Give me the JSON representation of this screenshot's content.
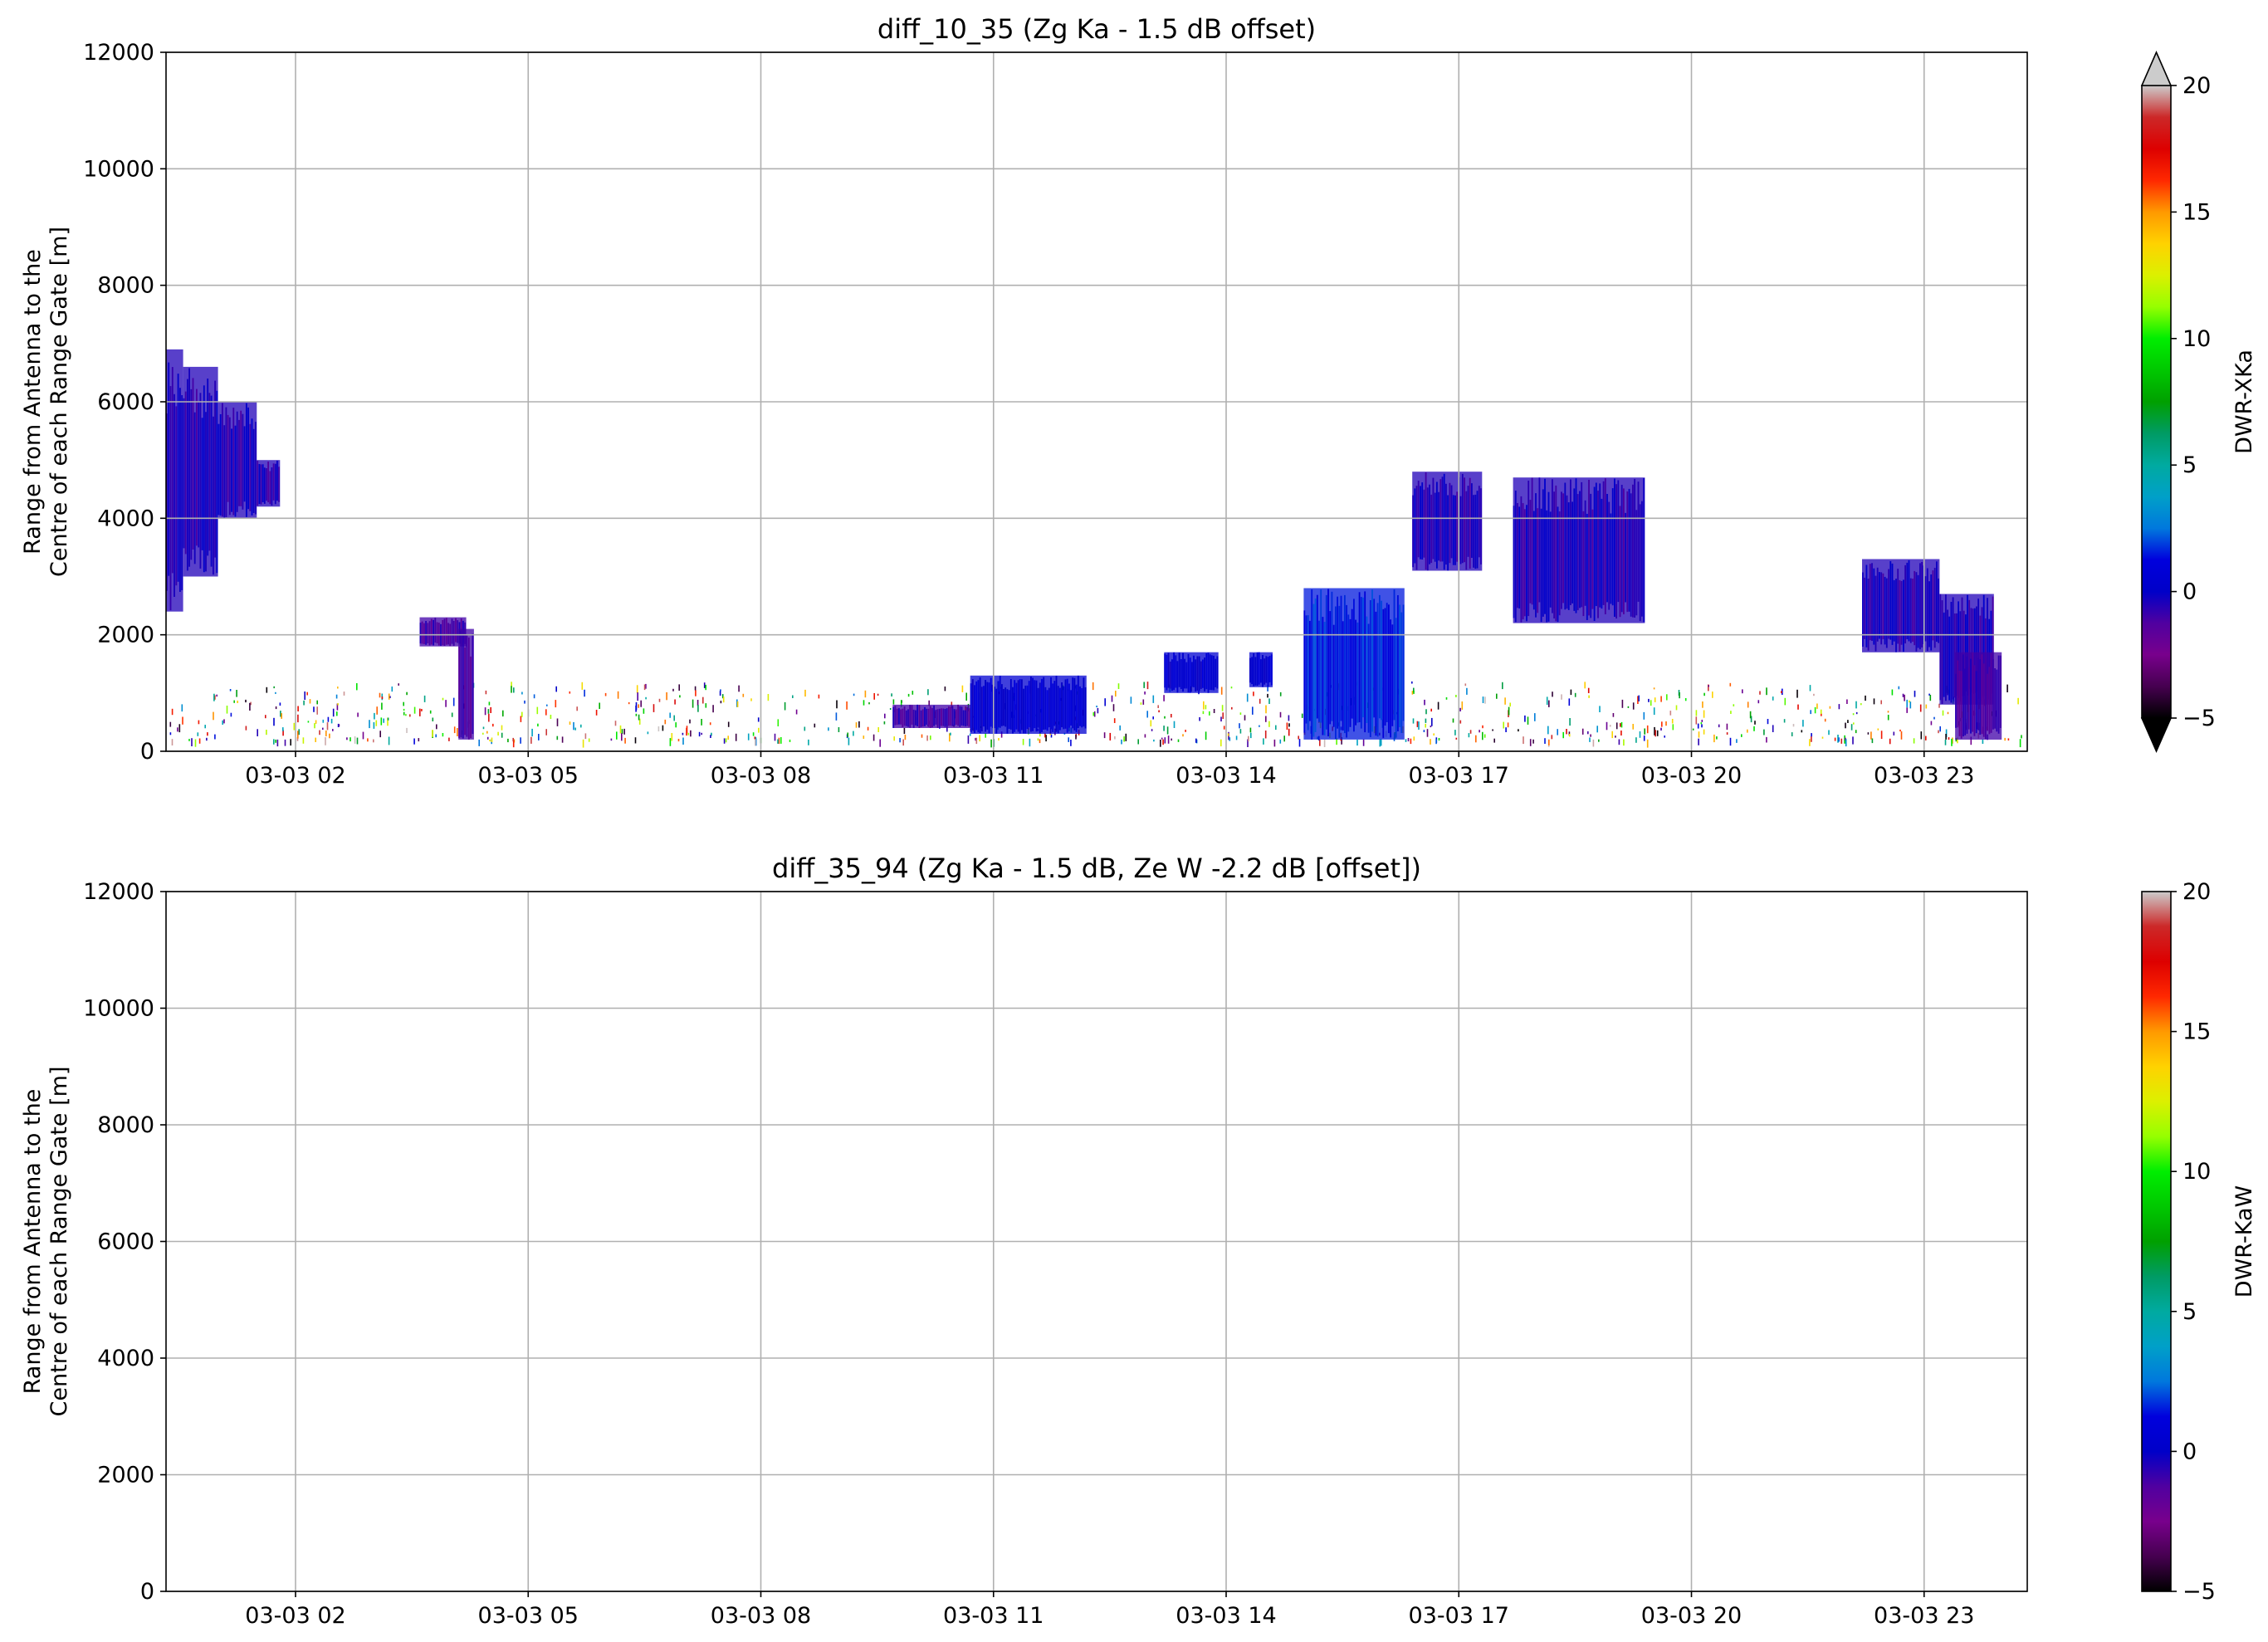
{
  "chart_data": [
    {
      "type": "heatmap",
      "title": "diff_10_35 (Zg Ka - 1.5 dB offset)",
      "xlabel": "",
      "ylabel_lines": [
        "Range from Antenna to the",
        "Centre of each Range Gate [m]"
      ],
      "x_unit": "hours since 03-03 00:00",
      "xlim": [
        0.33,
        24.33
      ],
      "x_tick_values": [
        2,
        5,
        8,
        11,
        14,
        17,
        20,
        23
      ],
      "x_tick_labels": [
        "03-03 02",
        "03-03 05",
        "03-03 08",
        "03-03 11",
        "03-03 14",
        "03-03 17",
        "03-03 20",
        "03-03 23"
      ],
      "ylim": [
        0,
        12000
      ],
      "y_tick_values": [
        0,
        2000,
        4000,
        6000,
        8000,
        10000,
        12000
      ],
      "y_tick_labels": [
        "0",
        "2000",
        "4000",
        "6000",
        "8000",
        "10000",
        "12000"
      ],
      "grid": true,
      "colorbar": {
        "label": "DWR-XKa",
        "range": [
          -5,
          20
        ],
        "tick_values": [
          -5,
          0,
          5,
          10,
          15,
          20
        ],
        "tick_labels": [
          "−5",
          "0",
          "5",
          "10",
          "15",
          "20"
        ],
        "extend": "both",
        "colormap": "nipy_spectral"
      },
      "echo_regions": [
        {
          "x0": 0.33,
          "x1": 0.55,
          "y_bottom": 2400,
          "y_top": 6900,
          "value": -0.5
        },
        {
          "x0": 0.55,
          "x1": 1.0,
          "y_bottom": 3000,
          "y_top": 6600,
          "value": -0.5
        },
        {
          "x0": 1.0,
          "x1": 1.5,
          "y_bottom": 4000,
          "y_top": 6000,
          "value": -0.5
        },
        {
          "x0": 1.5,
          "x1": 1.8,
          "y_bottom": 4200,
          "y_top": 5000,
          "value": -0.5
        },
        {
          "x0": 3.6,
          "x1": 4.2,
          "y_bottom": 1800,
          "y_top": 2300,
          "value": -1.0
        },
        {
          "x0": 4.1,
          "x1": 4.3,
          "y_bottom": 200,
          "y_top": 2100,
          "value": -1.0
        },
        {
          "x0": 9.7,
          "x1": 10.7,
          "y_bottom": 400,
          "y_top": 800,
          "value": -1.0
        },
        {
          "x0": 10.7,
          "x1": 12.2,
          "y_bottom": 300,
          "y_top": 1300,
          "value": 0.5
        },
        {
          "x0": 13.2,
          "x1": 13.9,
          "y_bottom": 1000,
          "y_top": 1700,
          "value": 0.5
        },
        {
          "x0": 14.3,
          "x1": 14.6,
          "y_bottom": 1100,
          "y_top": 1700,
          "value": 0.5
        },
        {
          "x0": 15.0,
          "x1": 16.3,
          "y_bottom": 200,
          "y_top": 2800,
          "value": 1.5
        },
        {
          "x0": 16.4,
          "x1": 17.3,
          "y_bottom": 3100,
          "y_top": 4800,
          "value": -0.5
        },
        {
          "x0": 17.7,
          "x1": 19.4,
          "y_bottom": 2200,
          "y_top": 4700,
          "value": -0.5
        },
        {
          "x0": 22.2,
          "x1": 23.2,
          "y_bottom": 1700,
          "y_top": 3300,
          "value": -0.5
        },
        {
          "x0": 23.2,
          "x1": 23.9,
          "y_bottom": 800,
          "y_top": 2700,
          "value": -0.5
        },
        {
          "x0": 23.4,
          "x1": 24.0,
          "y_bottom": 200,
          "y_top": 1700,
          "value": -1.0
        }
      ],
      "noise_band": {
        "x0": 0.33,
        "x1": 24.33,
        "y_bottom": 200,
        "y_top": 1200,
        "value_range": [
          -5,
          20
        ]
      }
    },
    {
      "type": "heatmap",
      "title": "diff_35_94 (Zg Ka - 1.5 dB, Ze W -2.2 dB [offset])",
      "xlabel": "",
      "ylabel_lines": [
        "Range from Antenna to the",
        "Centre of each Range Gate [m]"
      ],
      "x_unit": "hours since 03-03 00:00",
      "xlim": [
        0.33,
        24.33
      ],
      "x_tick_values": [
        2,
        5,
        8,
        11,
        14,
        17,
        20,
        23
      ],
      "x_tick_labels": [
        "03-03 02",
        "03-03 05",
        "03-03 08",
        "03-03 11",
        "03-03 14",
        "03-03 17",
        "03-03 20",
        "03-03 23"
      ],
      "ylim": [
        0,
        12000
      ],
      "y_tick_values": [
        0,
        2000,
        4000,
        6000,
        8000,
        10000,
        12000
      ],
      "y_tick_labels": [
        "0",
        "2000",
        "4000",
        "6000",
        "8000",
        "10000",
        "12000"
      ],
      "grid": true,
      "colorbar": {
        "label": "DWR-KaW",
        "range": [
          -5,
          20
        ],
        "tick_values": [
          -5,
          0,
          5,
          10,
          15,
          20
        ],
        "tick_labels": [
          "−5",
          "0",
          "5",
          "10",
          "15",
          "20"
        ],
        "extend": "neither",
        "colormap": "nipy_spectral"
      },
      "echo_regions": [],
      "noise_band": null
    }
  ]
}
